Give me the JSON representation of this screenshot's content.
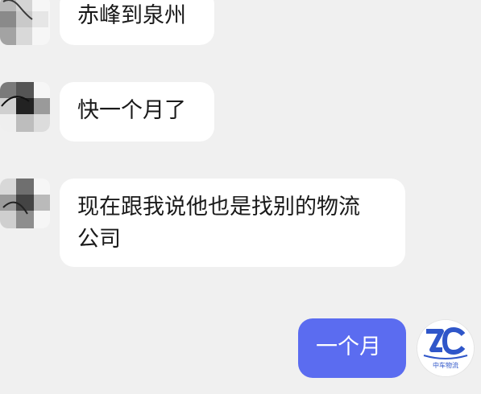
{
  "messages": [
    {
      "id": "m1",
      "side": "left",
      "text": "赤峰到泉州"
    },
    {
      "id": "m2",
      "side": "left",
      "text": "快一个月了"
    },
    {
      "id": "m3",
      "side": "left",
      "text": "现在跟我说他也是找别的物流",
      "text2": "公司"
    },
    {
      "id": "m4",
      "side": "right",
      "text": "一个月"
    }
  ],
  "self_avatar": {
    "logo_letters": "ZC",
    "logo_caption": "中车物流",
    "color": "#2f56c9"
  },
  "colors": {
    "background": "#f0f0f0",
    "bubble_other": "#ffffff",
    "bubble_self": "#5b6cf0"
  }
}
